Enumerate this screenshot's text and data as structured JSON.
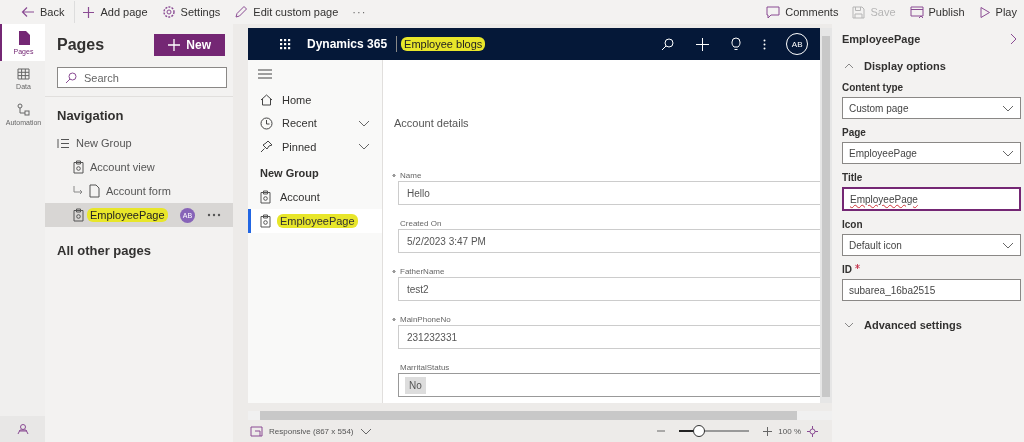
{
  "toolbar": {
    "left": [
      {
        "label": "Back",
        "kind": "back"
      },
      {
        "label": "Add page",
        "kind": "add"
      },
      {
        "label": "Settings",
        "kind": "gear"
      },
      {
        "label": "Edit custom page",
        "kind": "pencil"
      },
      {
        "label": "···",
        "kind": "more"
      }
    ],
    "right": [
      {
        "label": "Comments",
        "kind": "comment",
        "disabled": false
      },
      {
        "label": "Save",
        "kind": "save",
        "disabled": true
      },
      {
        "label": "Publish",
        "kind": "publish",
        "disabled": false
      },
      {
        "label": "Play",
        "kind": "play",
        "disabled": false
      }
    ]
  },
  "rail": [
    {
      "label": "Pages",
      "kind": "page",
      "selected": true
    },
    {
      "label": "Data",
      "kind": "grid",
      "selected": false
    },
    {
      "label": "Automation",
      "kind": "flow",
      "selected": false
    }
  ],
  "pages_panel": {
    "title": "Pages",
    "new_button": "New",
    "search": {
      "placeholder": "Search"
    },
    "navigation_heading": "Navigation",
    "items": [
      {
        "label": "New Group",
        "kind": "group",
        "selected": false,
        "highlighted": false,
        "children": [
          {
            "label": "Account view",
            "kind": "view",
            "selected": false,
            "highlighted": false
          },
          {
            "label": "Account form",
            "kind": "form",
            "selected": false,
            "highlighted": false
          },
          {
            "label": "EmployeePage",
            "kind": "view",
            "selected": true,
            "highlighted": true,
            "avatar": "AB"
          }
        ]
      }
    ],
    "other_heading": "All other pages"
  },
  "preview": {
    "app_name": "Dynamics 365",
    "area_name": "Employee blogs",
    "area_highlighted": true,
    "avatar": "AB",
    "nav": [
      {
        "label": "Home",
        "kind": "home",
        "expandable": false
      },
      {
        "label": "Recent",
        "kind": "clock",
        "expandable": true
      },
      {
        "label": "Pinned",
        "kind": "pin",
        "expandable": true
      }
    ],
    "nav_group": "New Group",
    "group_items": [
      {
        "label": "Account",
        "selected": false,
        "highlighted": false
      },
      {
        "label": "EmployeePage",
        "selected": true,
        "highlighted": true
      }
    ],
    "form_title": "Account details",
    "fields": [
      {
        "label": "Name",
        "required": true,
        "value": "Hello",
        "kind": "text"
      },
      {
        "label": "Created On",
        "required": false,
        "value": "5/2/2023 3:47 PM",
        "kind": "text"
      },
      {
        "label": "FatherName",
        "required": true,
        "value": "test2",
        "kind": "text"
      },
      {
        "label": "MainPhoneNo",
        "required": true,
        "value": "231232331",
        "kind": "text"
      },
      {
        "label": "MarritalStatus",
        "required": false,
        "value": "No",
        "kind": "choice"
      }
    ]
  },
  "footer": {
    "viewport": "Responsive (867 x 554)",
    "zoom": {
      "level": 0.24,
      "reading": "100 %"
    }
  },
  "properties": {
    "title": "EmployeePage",
    "section": "Display options",
    "section_expanded": true,
    "fields": [
      {
        "label": "Content type",
        "kind": "dropdown",
        "value": "Custom page",
        "required": false
      },
      {
        "label": "Page",
        "kind": "dropdown",
        "value": "EmployeePage",
        "required": false
      },
      {
        "label": "Title",
        "kind": "text",
        "value": "EmployeePage",
        "required": false,
        "focused": true
      },
      {
        "label": "Icon",
        "kind": "dropdown",
        "value": "Default icon",
        "required": false
      },
      {
        "label": "ID",
        "kind": "text",
        "value": "subarea_16ba2515",
        "required": true,
        "focused": false
      }
    ],
    "advanced": "Advanced settings",
    "advanced_expanded": false
  }
}
